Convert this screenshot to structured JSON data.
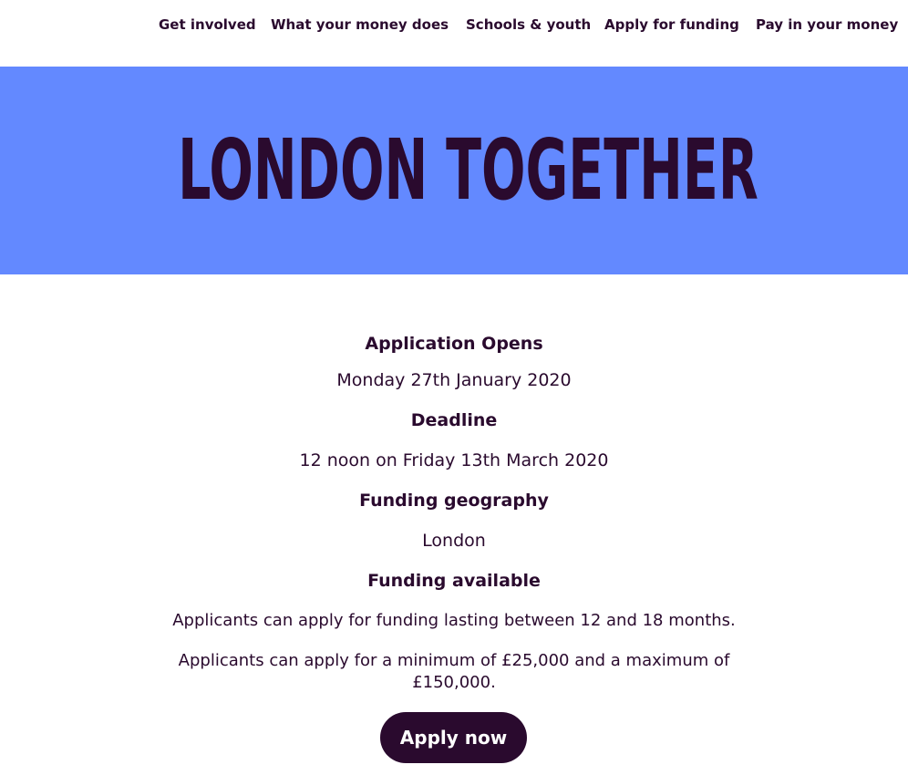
{
  "nav": {
    "items": [
      {
        "label": "Get involved"
      },
      {
        "label": "What your money does"
      },
      {
        "label": "Schools & youth"
      },
      {
        "label": "Apply for funding"
      },
      {
        "label": "Pay in your money"
      }
    ]
  },
  "hero": {
    "title": "LONDON TOGETHER",
    "background_color": "#6389ff",
    "text_color": "#2a0a2e"
  },
  "details": {
    "opens_heading": "Application Opens",
    "opens_value": "Monday 27th January 2020",
    "deadline_heading": "Deadline",
    "deadline_value": "12 noon on Friday 13th March 2020",
    "geography_heading": "Funding geography",
    "geography_value": "London",
    "available_heading": "Funding available",
    "available_duration": "Applicants can apply for funding lasting between 12 and 18 months.",
    "available_amount": "Applicants can apply for a minimum of £25,000 and a maximum of £150,000."
  },
  "cta": {
    "label": "Apply now",
    "background_color": "#2a0a2e"
  }
}
